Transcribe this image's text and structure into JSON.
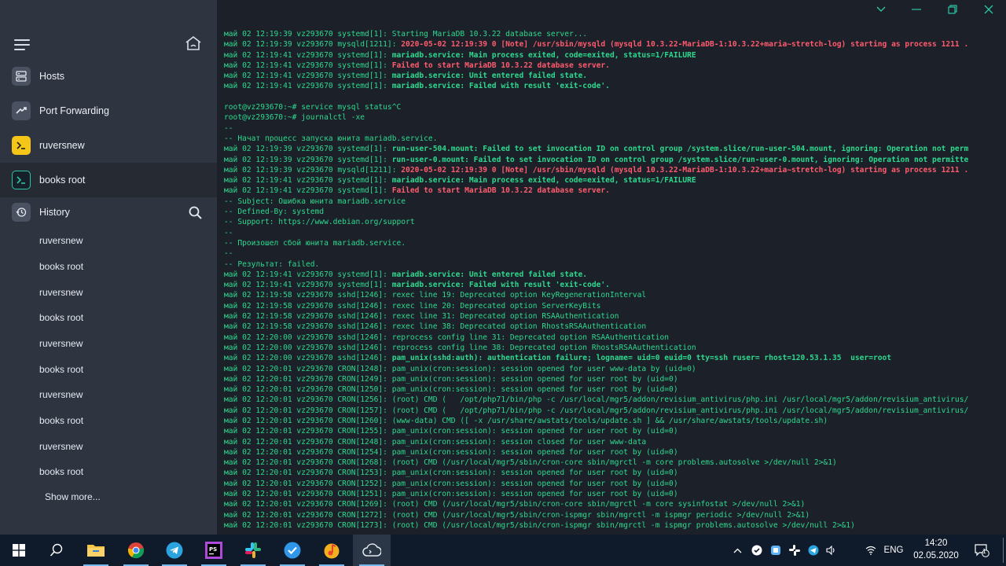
{
  "sidebar": {
    "nav": [
      {
        "label": "Hosts",
        "icon": "server-icon"
      },
      {
        "label": "Port Forwarding",
        "icon": "port-forwarding-icon"
      },
      {
        "label": "ruversnew",
        "icon": "terminal-icon"
      },
      {
        "label": "books root",
        "icon": "terminal-icon"
      }
    ],
    "history_label": "History",
    "history": [
      "ruversnew",
      "books root",
      "ruversnew",
      "books root",
      "ruversnew",
      "books root",
      "ruversnew",
      "books root",
      "ruversnew",
      "books root"
    ],
    "show_more": "Show more..."
  },
  "terminal": {
    "lines": [
      [
        {
          "t": "май 02 12:19:39 vz293670 systemd[1]: Starting MariaDB 10.3.22 database server..."
        }
      ],
      [
        {
          "t": "май 02 12:19:39 vz293670 mysqld[1211]: "
        },
        {
          "t": "2020-05-02 12:19:39 0 [Note] /usr/sbin/mysqld (mysqld 10.3.22-MariaDB-1:10.3.22+maria~stretch-log) starting as process 1211 .",
          "c": "red"
        }
      ],
      [
        {
          "t": "май 02 12:19:41 vz293670 systemd[1]: "
        },
        {
          "t": "mariadb.service: Main process exited, code=exited, status=1/FAILURE",
          "c": "bold"
        }
      ],
      [
        {
          "t": "май 02 12:19:41 vz293670 systemd[1]: "
        },
        {
          "t": "Failed to start MariaDB 10.3.22 database server.",
          "c": "red"
        }
      ],
      [
        {
          "t": "май 02 12:19:41 vz293670 systemd[1]: "
        },
        {
          "t": "mariadb.service: Unit entered failed state.",
          "c": "bold"
        }
      ],
      [
        {
          "t": "май 02 12:19:41 vz293670 systemd[1]: "
        },
        {
          "t": "mariadb.service: Failed with result 'exit-code'.",
          "c": "bold"
        }
      ],
      [
        {
          "t": ""
        }
      ],
      [
        {
          "t": "root@vz293670:~# service mysql status^C"
        }
      ],
      [
        {
          "t": "root@vz293670:~# journalctl -xe"
        }
      ],
      [
        {
          "t": "--"
        }
      ],
      [
        {
          "t": "-- Начат процесс запуска юнита mariadb.service."
        }
      ],
      [
        {
          "t": "май 02 12:19:39 vz293670 systemd[1]: "
        },
        {
          "t": "run-user-504.mount: Failed to set invocation ID on control group /system.slice/run-user-504.mount, ignoring: Operation not perm",
          "c": "bold"
        }
      ],
      [
        {
          "t": "май 02 12:19:39 vz293670 systemd[1]: "
        },
        {
          "t": "run-user-0.mount: Failed to set invocation ID on control group /system.slice/run-user-0.mount, ignoring: Operation not permitte",
          "c": "bold"
        }
      ],
      [
        {
          "t": "май 02 12:19:39 vz293670 mysqld[1211]: "
        },
        {
          "t": "2020-05-02 12:19:39 0 [Note] /usr/sbin/mysqld (mysqld 10.3.22-MariaDB-1:10.3.22+maria~stretch-log) starting as process 1211 .",
          "c": "red"
        }
      ],
      [
        {
          "t": "май 02 12:19:41 vz293670 systemd[1]: "
        },
        {
          "t": "mariadb.service: Main process exited, code=exited, status=1/FAILURE",
          "c": "bold"
        }
      ],
      [
        {
          "t": "май 02 12:19:41 vz293670 systemd[1]: "
        },
        {
          "t": "Failed to start MariaDB 10.3.22 database server.",
          "c": "red"
        }
      ],
      [
        {
          "t": "-- Subject: Ошибка юнита mariadb.service"
        }
      ],
      [
        {
          "t": "-- Defined-By: systemd"
        }
      ],
      [
        {
          "t": "-- Support: https://www.debian.org/support"
        }
      ],
      [
        {
          "t": "--"
        }
      ],
      [
        {
          "t": "-- Произошел сбой юнита mariadb.service."
        }
      ],
      [
        {
          "t": "--"
        }
      ],
      [
        {
          "t": "-- Результат: failed."
        }
      ],
      [
        {
          "t": "май 02 12:19:41 vz293670 systemd[1]: "
        },
        {
          "t": "mariadb.service: Unit entered failed state.",
          "c": "bold"
        }
      ],
      [
        {
          "t": "май 02 12:19:41 vz293670 systemd[1]: "
        },
        {
          "t": "mariadb.service: Failed with result 'exit-code'.",
          "c": "bold"
        }
      ],
      [
        {
          "t": "май 02 12:19:58 vz293670 sshd[1246]: rexec line 19: Deprecated option KeyRegenerationInterval"
        }
      ],
      [
        {
          "t": "май 02 12:19:58 vz293670 sshd[1246]: rexec line 20: Deprecated option ServerKeyBits"
        }
      ],
      [
        {
          "t": "май 02 12:19:58 vz293670 sshd[1246]: rexec line 31: Deprecated option RSAAuthentication"
        }
      ],
      [
        {
          "t": "май 02 12:19:58 vz293670 sshd[1246]: rexec line 38: Deprecated option RhostsRSAAuthentication"
        }
      ],
      [
        {
          "t": "май 02 12:20:00 vz293670 sshd[1246]: reprocess config line 31: Deprecated option RSAAuthentication"
        }
      ],
      [
        {
          "t": "май 02 12:20:00 vz293670 sshd[1246]: reprocess config line 38: Deprecated option RhostsRSAAuthentication"
        }
      ],
      [
        {
          "t": "май 02 12:20:00 vz293670 sshd[1246]: "
        },
        {
          "t": "pam_unix(sshd:auth): authentication failure; logname= uid=0 euid=0 tty=ssh ruser= rhost=120.53.1.35  user=root",
          "c": "bold"
        }
      ],
      [
        {
          "t": "май 02 12:20:01 vz293670 CRON[1248]: pam_unix(cron:session): session opened for user www-data by (uid=0)"
        }
      ],
      [
        {
          "t": "май 02 12:20:01 vz293670 CRON[1249]: pam_unix(cron:session): session opened for user root by (uid=0)"
        }
      ],
      [
        {
          "t": "май 02 12:20:01 vz293670 CRON[1250]: pam_unix(cron:session): session opened for user root by (uid=0)"
        }
      ],
      [
        {
          "t": "май 02 12:20:01 vz293670 CRON[1256]: (root) CMD (   /opt/php71/bin/php -c /usr/local/mgr5/addon/revisium_antivirus/php.ini /usr/local/mgr5/addon/revisium_antivirus/"
        }
      ],
      [
        {
          "t": "май 02 12:20:01 vz293670 CRON[1257]: (root) CMD (   /opt/php71/bin/php -c /usr/local/mgr5/addon/revisium_antivirus/php.ini /usr/local/mgr5/addon/revisium_antivirus/"
        }
      ],
      [
        {
          "t": "май 02 12:20:01 vz293670 CRON[1260]: (www-data) CMD ([ -x /usr/share/awstats/tools/update.sh ] && /usr/share/awstats/tools/update.sh)"
        }
      ],
      [
        {
          "t": "май 02 12:20:01 vz293670 CRON[1255]: pam_unix(cron:session): session opened for user root by (uid=0)"
        }
      ],
      [
        {
          "t": "май 02 12:20:01 vz293670 CRON[1248]: pam_unix(cron:session): session closed for user www-data"
        }
      ],
      [
        {
          "t": "май 02 12:20:01 vz293670 CRON[1254]: pam_unix(cron:session): session opened for user root by (uid=0)"
        }
      ],
      [
        {
          "t": "май 02 12:20:01 vz293670 CRON[1268]: (root) CMD (/usr/local/mgr5/sbin/cron-core sbin/mgrctl -m core problems.autosolve >/dev/null 2>&1)"
        }
      ],
      [
        {
          "t": "май 02 12:20:01 vz293670 CRON[1253]: pam_unix(cron:session): session opened for user root by (uid=0)"
        }
      ],
      [
        {
          "t": "май 02 12:20:01 vz293670 CRON[1252]: pam_unix(cron:session): session opened for user root by (uid=0)"
        }
      ],
      [
        {
          "t": "май 02 12:20:01 vz293670 CRON[1251]: pam_unix(cron:session): session opened for user root by (uid=0)"
        }
      ],
      [
        {
          "t": "май 02 12:20:01 vz293670 CRON[1269]: (root) CMD (/usr/local/mgr5/sbin/cron-core sbin/mgrctl -m core sysinfostat >/dev/null 2>&1)"
        }
      ],
      [
        {
          "t": "май 02 12:20:01 vz293670 CRON[1272]: (root) CMD (/usr/local/mgr5/sbin/cron-ispmgr sbin/mgrctl -m ispmgr periodic >/dev/null 2>&1)"
        }
      ],
      [
        {
          "t": "май 02 12:20:01 vz293670 CRON[1273]: (root) CMD (/usr/local/mgr5/sbin/cron-ispmgr sbin/mgrctl -m ispmgr problems.autosolve >/dev/null 2>&1)"
        }
      ]
    ]
  },
  "taskbar": {
    "apps": [
      "start-icon",
      "search-icon",
      "file-explorer-icon",
      "chrome-icon",
      "telegram-icon",
      "phpstorm-icon",
      "slack-icon",
      "todo-icon",
      "music-icon",
      "termius-icon"
    ],
    "language": "ENG",
    "time": "14:20",
    "date": "02.05.2020",
    "notification_count": "1"
  },
  "colors": {
    "terminal_green": "#2dd98f",
    "terminal_red": "#ff5a6e",
    "accent_teal": "#2ec4a6"
  }
}
